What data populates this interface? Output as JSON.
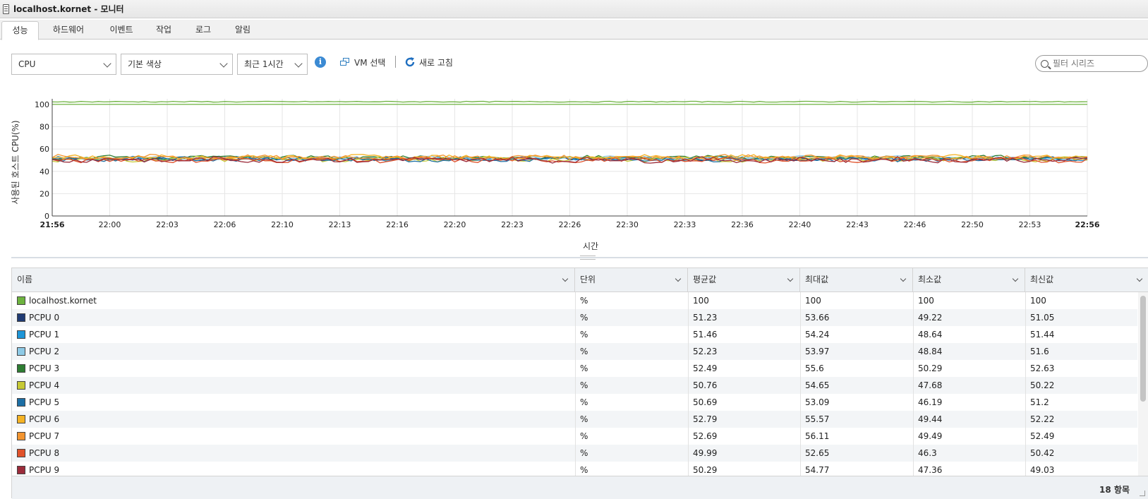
{
  "window": {
    "title": "localhost.kornet - 모니터"
  },
  "tabs": [
    {
      "label": "성능",
      "active": true
    },
    {
      "label": "하드웨어"
    },
    {
      "label": "이벤트"
    },
    {
      "label": "작업"
    },
    {
      "label": "로그"
    },
    {
      "label": "알림"
    }
  ],
  "toolbar": {
    "metric_select": "CPU",
    "color_select": "기본 색상",
    "range_select": "최근 1시간",
    "info_icon": "info-icon",
    "vm_select_label": "VM 선택",
    "refresh_label": "새로 고침",
    "filter_placeholder": "필터 시리즈"
  },
  "chart_data": {
    "type": "line",
    "ylabel": "사용된 호스트 CPU(%)",
    "xlabel": "시간",
    "ylim": [
      0,
      105
    ],
    "yticks": [
      0,
      20,
      40,
      60,
      80,
      100
    ],
    "xticks": [
      "21:56",
      "22:00",
      "22:03",
      "22:06",
      "22:10",
      "22:13",
      "22:16",
      "22:20",
      "22:23",
      "22:26",
      "22:30",
      "22:33",
      "22:36",
      "22:40",
      "22:43",
      "22:46",
      "22:50",
      "22:53",
      "22:56"
    ],
    "grid": true,
    "series": [
      {
        "name": "localhost.kornet",
        "color": "#6db33f",
        "avg": 100,
        "max": 100,
        "min": 100
      },
      {
        "name": "PCPU 0",
        "color": "#1f3a73",
        "avg": 51.23,
        "max": 53.66,
        "min": 49.22
      },
      {
        "name": "PCPU 1",
        "color": "#1e96d8",
        "avg": 51.46,
        "max": 54.24,
        "min": 48.64
      },
      {
        "name": "PCPU 2",
        "color": "#8ecae6",
        "avg": 52.23,
        "max": 53.97,
        "min": 48.84
      },
      {
        "name": "PCPU 3",
        "color": "#2e7d32",
        "avg": 52.49,
        "max": 55.6,
        "min": 50.29
      },
      {
        "name": "PCPU 4",
        "color": "#c6c935",
        "avg": 50.76,
        "max": 54.65,
        "min": 47.68
      },
      {
        "name": "PCPU 5",
        "color": "#1d6fa5",
        "avg": 50.69,
        "max": 53.09,
        "min": 46.19
      },
      {
        "name": "PCPU 6",
        "color": "#f5b324",
        "avg": 52.79,
        "max": 55.57,
        "min": 49.44
      },
      {
        "name": "PCPU 7",
        "color": "#f39530",
        "avg": 52.69,
        "max": 56.11,
        "min": 49.49
      },
      {
        "name": "PCPU 8",
        "color": "#e0512a",
        "avg": 49.99,
        "max": 52.65,
        "min": 46.3
      },
      {
        "name": "PCPU 9",
        "color": "#9b2b3a",
        "avg": 50.29,
        "max": 54.77,
        "min": 47.36
      }
    ]
  },
  "table": {
    "columns": [
      "이름",
      "단위",
      "평균값",
      "최대값",
      "최소값",
      "최신값"
    ],
    "rows": [
      {
        "name": "localhost.kornet",
        "color": "#6db33f",
        "unit": "%",
        "avg": "100",
        "max": "100",
        "min": "100",
        "latest": "100"
      },
      {
        "name": "PCPU 0",
        "color": "#1f3a73",
        "unit": "%",
        "avg": "51.23",
        "max": "53.66",
        "min": "49.22",
        "latest": "51.05"
      },
      {
        "name": "PCPU 1",
        "color": "#1e96d8",
        "unit": "%",
        "avg": "51.46",
        "max": "54.24",
        "min": "48.64",
        "latest": "51.44"
      },
      {
        "name": "PCPU 2",
        "color": "#8ecae6",
        "unit": "%",
        "avg": "52.23",
        "max": "53.97",
        "min": "48.84",
        "latest": "51.6"
      },
      {
        "name": "PCPU 3",
        "color": "#2e7d32",
        "unit": "%",
        "avg": "52.49",
        "max": "55.6",
        "min": "50.29",
        "latest": "52.63"
      },
      {
        "name": "PCPU 4",
        "color": "#c6c935",
        "unit": "%",
        "avg": "50.76",
        "max": "54.65",
        "min": "47.68",
        "latest": "50.22"
      },
      {
        "name": "PCPU 5",
        "color": "#1d6fa5",
        "unit": "%",
        "avg": "50.69",
        "max": "53.09",
        "min": "46.19",
        "latest": "51.2"
      },
      {
        "name": "PCPU 6",
        "color": "#f5b324",
        "unit": "%",
        "avg": "52.79",
        "max": "55.57",
        "min": "49.44",
        "latest": "52.22"
      },
      {
        "name": "PCPU 7",
        "color": "#f39530",
        "unit": "%",
        "avg": "52.69",
        "max": "56.11",
        "min": "49.49",
        "latest": "52.49"
      },
      {
        "name": "PCPU 8",
        "color": "#e0512a",
        "unit": "%",
        "avg": "49.99",
        "max": "52.65",
        "min": "46.3",
        "latest": "50.42"
      },
      {
        "name": "PCPU 9",
        "color": "#9b2b3a",
        "unit": "%",
        "avg": "50.29",
        "max": "54.77",
        "min": "47.36",
        "latest": "49.03"
      }
    ],
    "footer_count": "18 항목"
  }
}
